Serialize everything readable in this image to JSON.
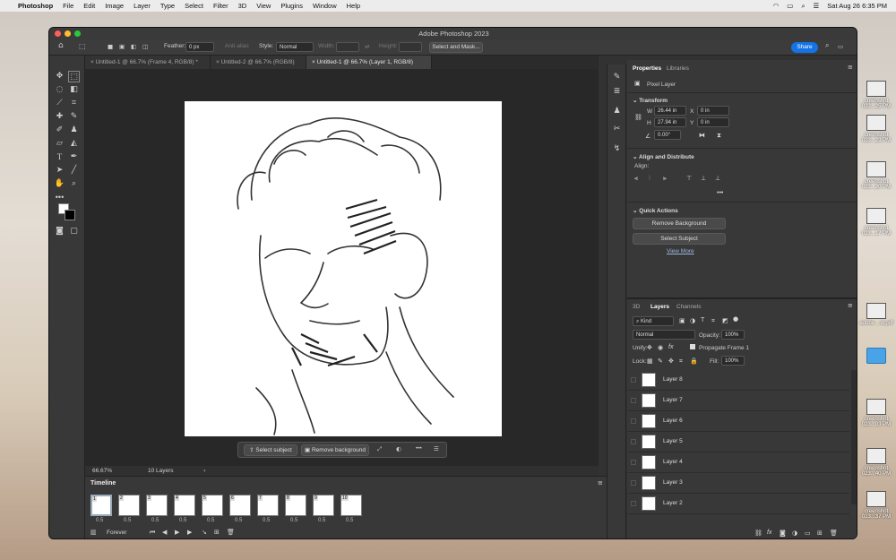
{
  "menubar": {
    "app": "Photoshop",
    "items": [
      "File",
      "Edit",
      "Image",
      "Layer",
      "Type",
      "Select",
      "Filter",
      "3D",
      "View",
      "Plugins",
      "Window",
      "Help"
    ],
    "datetime": "Sat Aug 26  6:35 PM"
  },
  "desktop": {
    "icons": [
      "creenshot 023...25 PM",
      "creenshot 023...23 PM",
      "creenshot 023...20 PM",
      "creenshot 023...17 PM",
      "adobe ...w.pdf",
      "creenshot 023...03 PM",
      "creenshot 023...40 PM",
      "creenshot 023...37 PM"
    ]
  },
  "window": {
    "title": "Adobe Photoshop 2023"
  },
  "options": {
    "feather_label": "Feather:",
    "feather_value": "0 px",
    "antialias": "Anti-alias",
    "style_label": "Style:",
    "style_value": "Normal",
    "width_label": "Width:",
    "height_label": "Height:",
    "select_mask": "Select and Mask...",
    "share": "Share"
  },
  "tabs": [
    "Untitled-1 @ 66.7% (Frame 4, RGB/8) *",
    "Untitled-2 @ 66.7% (RGB/8)",
    "Untitled-1 @ 66.7% (Layer 1, RGB/8)"
  ],
  "contextbar": {
    "select_subject": "Select subject",
    "remove_background": "Remove background"
  },
  "status": {
    "zoom": "66.67%",
    "layers": "10 Layers"
  },
  "timeline": {
    "title": "Timeline",
    "frames": [
      {
        "num": "1",
        "dur": "0.5"
      },
      {
        "num": "2",
        "dur": "0.5"
      },
      {
        "num": "3",
        "dur": "0.5"
      },
      {
        "num": "4",
        "dur": "0.5"
      },
      {
        "num": "5",
        "dur": "0.5"
      },
      {
        "num": "6",
        "dur": "0.5"
      },
      {
        "num": "7",
        "dur": "0.5"
      },
      {
        "num": "8",
        "dur": "0.5"
      },
      {
        "num": "9",
        "dur": "0.5"
      },
      {
        "num": "10",
        "dur": "0.5"
      }
    ],
    "loop": "Forever"
  },
  "properties": {
    "tab1": "Properties",
    "tab2": "Libraries",
    "kind": "Pixel Layer",
    "transform": "Transform",
    "w_label": "W",
    "w_value": "26.44 in",
    "x_label": "X",
    "x_value": "0 in",
    "h_label": "H",
    "h_value": "27.94 in",
    "y_label": "Y",
    "y_value": "0 in",
    "angle": "0.00°",
    "align": "Align and Distribute",
    "align_label": "Align:",
    "quick_actions": "Quick Actions",
    "remove_bg": "Remove Background",
    "select_subject": "Select Subject",
    "view_more": "View More"
  },
  "layers_panel": {
    "tab_3d": "3D",
    "tab_layers": "Layers",
    "tab_channels": "Channels",
    "kind_filter": "Kind",
    "blend": "Normal",
    "opacity_label": "Opacity:",
    "opacity": "100%",
    "unify_label": "Unify:",
    "propagate": "Propagate Frame 1",
    "lock_label": "Lock:",
    "fill_label": "Fill:",
    "fill": "100%",
    "layers": [
      "Layer 8",
      "Layer 7",
      "Layer 6",
      "Layer 5",
      "Layer 4",
      "Layer 3",
      "Layer 2"
    ]
  }
}
